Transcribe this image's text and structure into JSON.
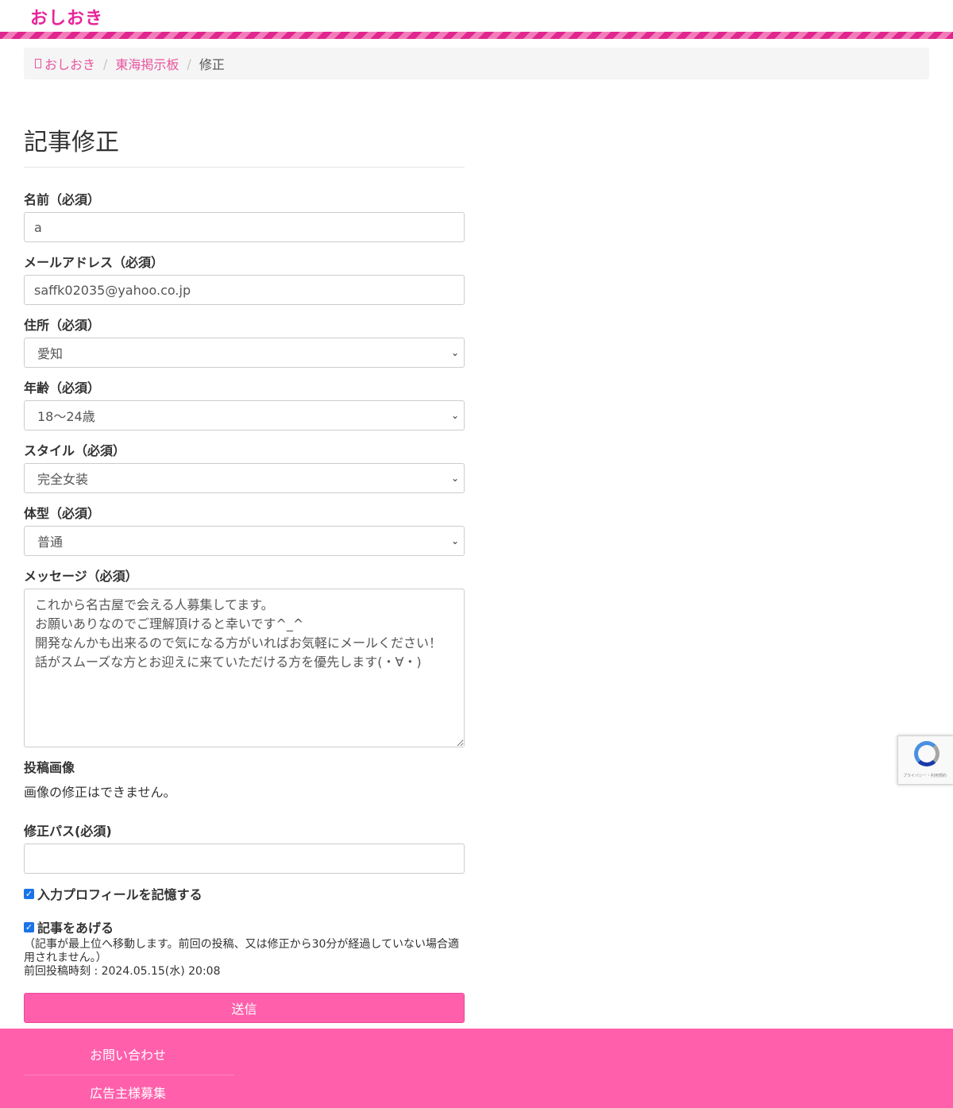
{
  "site": {
    "logo": "おしおき"
  },
  "breadcrumb": {
    "home": "おしおき",
    "board": "東海掲示板",
    "current": "修正"
  },
  "page_title": "記事修正",
  "form": {
    "name": {
      "label": "名前（必須）",
      "value": "a"
    },
    "email": {
      "label": "メールアドレス（必須）",
      "value": "saffk02035@yahoo.co.jp"
    },
    "address": {
      "label": "住所（必須）",
      "value": "愛知"
    },
    "age": {
      "label": "年齢（必須）",
      "value": "18〜24歳"
    },
    "style": {
      "label": "スタイル（必須）",
      "value": "完全女装"
    },
    "body_type": {
      "label": "体型（必須）",
      "value": "普通"
    },
    "message": {
      "label": "メッセージ（必須）",
      "value": "これから名古屋で会える人募集してます。\nお願いありなのでご理解頂けると幸いです^_^\n開発なんかも出来るので気になる方がいればお気軽にメールください！\n話がスムーズな方とお迎えに来ていただける方を優先します(・∀・)"
    },
    "image": {
      "label": "投稿画像",
      "note": "画像の修正はできません。"
    },
    "edit_pass": {
      "label": "修正パス(必須)",
      "value": ""
    },
    "remember_profile": {
      "label": "入力プロフィールを記憶する",
      "checked": true
    },
    "bump": {
      "label": "記事をあげる",
      "checked": true,
      "note": "（記事が最上位へ移動します。前回の投稿、又は修正から30分が経過していない場合適用されません。）",
      "last_post": "前回投稿時刻 : 2024.05.15(水) 20:08"
    },
    "submit_label": "送信"
  },
  "footer": {
    "contact": "お問い合わせ",
    "advertisers": "広告主様募集"
  },
  "recaptcha": {
    "text": "プライバシー・利用規約"
  },
  "colors": {
    "brand": "#e8259a",
    "button": "#ff5fab",
    "footer": "#ff5fab",
    "link": "#e8559e"
  }
}
